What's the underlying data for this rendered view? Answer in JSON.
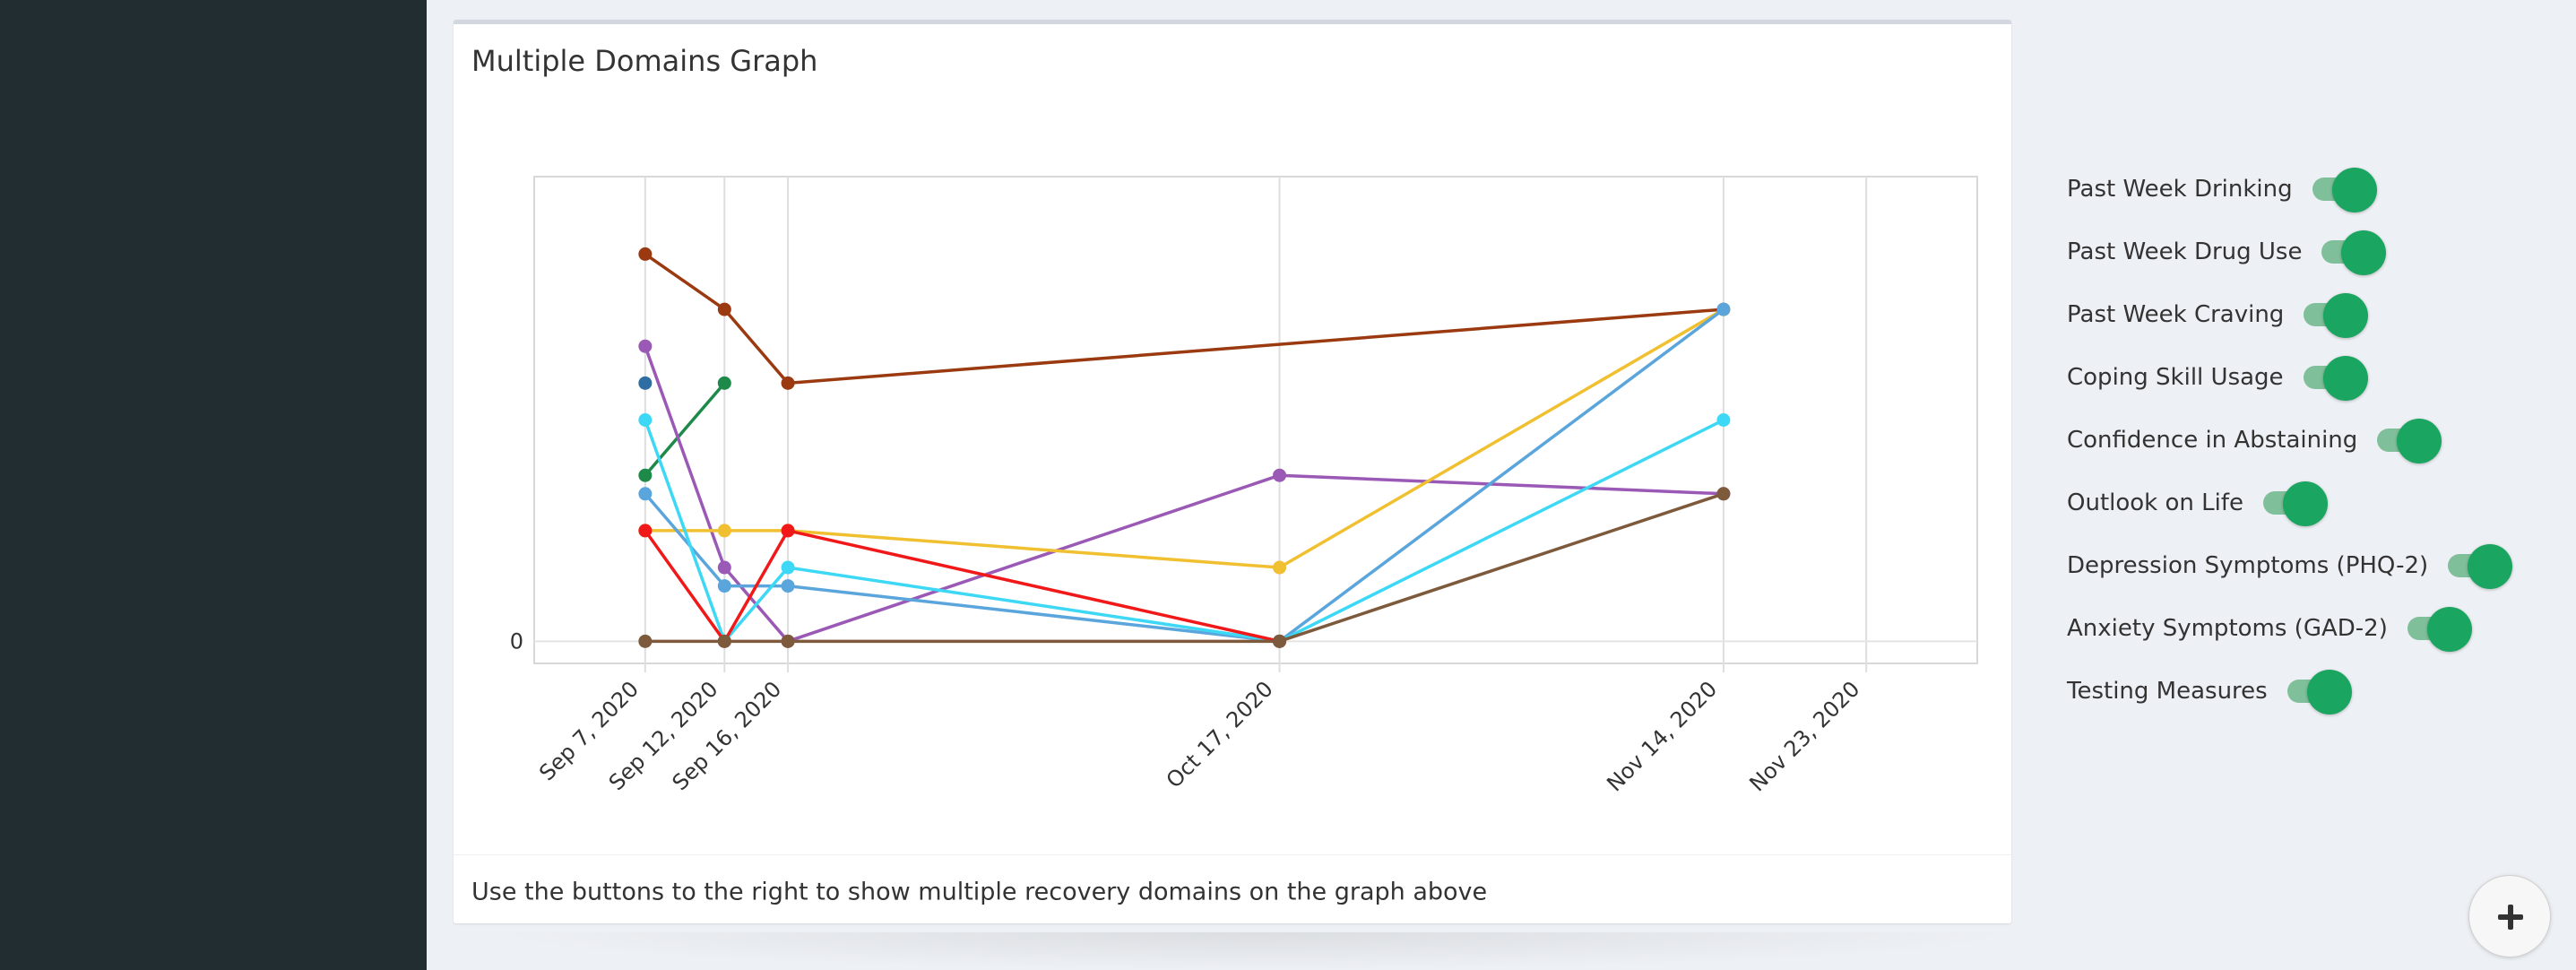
{
  "card": {
    "title": "Multiple Domains Graph",
    "footer": "Use the buttons to the right to show multiple recovery domains on the graph above"
  },
  "toggles": [
    {
      "label": "Past Week Drinking",
      "on": true
    },
    {
      "label": "Past Week Drug Use",
      "on": true
    },
    {
      "label": "Past Week Craving",
      "on": true
    },
    {
      "label": "Coping Skill Usage",
      "on": true
    },
    {
      "label": "Confidence in Abstaining",
      "on": true
    },
    {
      "label": "Outlook on Life",
      "on": true
    },
    {
      "label": "Depression Symptoms (PHQ-2)",
      "on": true
    },
    {
      "label": "Anxiety Symptoms (GAD-2)",
      "on": true
    },
    {
      "label": "Testing Measures",
      "on": true
    }
  ],
  "colors": {
    "sidebar": "#222d32",
    "toggle_on": "#1aa560",
    "toggle_track": "#7fbf9a"
  },
  "fab": {
    "icon": "plus-icon"
  },
  "chart_data": {
    "type": "line",
    "x": [
      "2020-09-07",
      "2020-09-12",
      "2020-09-16",
      "2020-10-17",
      "2020-11-14",
      "2020-11-23"
    ],
    "x_tick_labels": [
      "Sep 7, 2020",
      "Sep 12, 2020",
      "Sep 16, 2020",
      "Oct 17, 2020",
      "Nov 14, 2020",
      "Nov 23, 2020"
    ],
    "y_tick_labels": [
      "0"
    ],
    "ylim": [
      -0.6,
      12.6
    ],
    "grid": true,
    "series": [
      {
        "color": "#9b3a10",
        "points": [
          [
            "2020-09-07",
            10.5
          ],
          [
            "2020-09-12",
            9
          ],
          [
            "2020-09-16",
            7
          ],
          [
            "2020-11-14",
            9
          ]
        ]
      },
      {
        "color": "#2f6ea3",
        "points": [
          [
            "2020-09-07",
            7
          ]
        ]
      },
      {
        "color": "#1e8a4a",
        "points": [
          [
            "2020-09-07",
            4.5
          ],
          [
            "2020-09-12",
            7
          ]
        ]
      },
      {
        "color": "#9b59b6",
        "points": [
          [
            "2020-09-07",
            8
          ],
          [
            "2020-09-12",
            2
          ],
          [
            "2020-09-16",
            0
          ],
          [
            "2020-10-17",
            4.5
          ],
          [
            "2020-11-14",
            4
          ]
        ]
      },
      {
        "color": "#f0c030",
        "points": [
          [
            "2020-09-07",
            3
          ],
          [
            "2020-09-12",
            3
          ],
          [
            "2020-09-16",
            3
          ],
          [
            "2020-10-17",
            2
          ],
          [
            "2020-11-14",
            9
          ]
        ]
      },
      {
        "color": "#5aa5dc",
        "points": [
          [
            "2020-09-07",
            4
          ],
          [
            "2020-09-12",
            1.5
          ],
          [
            "2020-09-16",
            1.5
          ],
          [
            "2020-10-17",
            0
          ],
          [
            "2020-11-14",
            9
          ]
        ]
      },
      {
        "color": "#3dd8f5",
        "points": [
          [
            "2020-09-07",
            6
          ],
          [
            "2020-09-12",
            0
          ],
          [
            "2020-09-16",
            2
          ],
          [
            "2020-10-17",
            0
          ],
          [
            "2020-11-14",
            6
          ]
        ]
      },
      {
        "color": "#f01818",
        "points": [
          [
            "2020-09-07",
            3
          ],
          [
            "2020-09-12",
            0
          ],
          [
            "2020-09-16",
            3
          ],
          [
            "2020-10-17",
            0
          ]
        ]
      },
      {
        "color": "#7d5a3c",
        "points": [
          [
            "2020-09-07",
            0
          ],
          [
            "2020-09-12",
            0
          ],
          [
            "2020-09-16",
            0
          ],
          [
            "2020-10-17",
            0
          ],
          [
            "2020-11-14",
            4
          ]
        ]
      }
    ]
  }
}
